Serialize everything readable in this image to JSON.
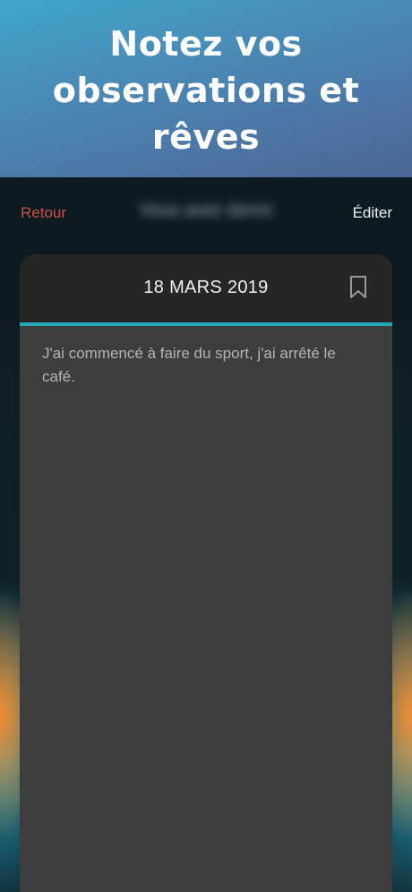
{
  "hero": {
    "title_line1": "Notez vos",
    "title_line2": "observations et rêves"
  },
  "navbar": {
    "back_label": "Retour",
    "title": "Vous avez dormi",
    "edit_label": "Éditer"
  },
  "entry": {
    "date": "18 MARS 2019",
    "bookmark_icon": "bookmark-icon",
    "text": "J'ai commencé à faire du sport, j'ai arrêté le café."
  },
  "colors": {
    "accent": "#25a7b8",
    "back_link": "#c0544a"
  }
}
